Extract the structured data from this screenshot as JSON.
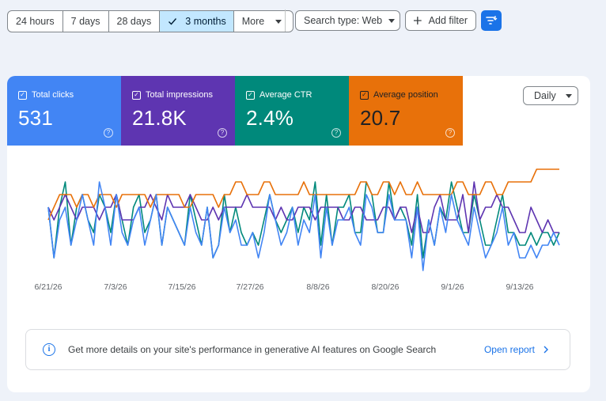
{
  "toolbar": {
    "ranges": [
      {
        "label": "24 hours",
        "active": false
      },
      {
        "label": "7 days",
        "active": false
      },
      {
        "label": "28 days",
        "active": false
      },
      {
        "label": "3 months",
        "active": true
      },
      {
        "label": "More",
        "active": false
      }
    ],
    "search_type": "Search type: Web",
    "add_filter": "Add filter"
  },
  "metrics": [
    {
      "label": "Total clicks",
      "value": "531",
      "color": "#4285f4"
    },
    {
      "label": "Total impressions",
      "value": "21.8K",
      "color": "#5e35b1"
    },
    {
      "label": "Average CTR",
      "value": "2.4%",
      "color": "#00897b"
    },
    {
      "label": "Average position",
      "value": "20.7",
      "color": "#e8710a"
    }
  ],
  "granularity": "Daily",
  "chart_data": {
    "type": "line",
    "x_tick_labels": [
      "6/21/26",
      "7/3/26",
      "7/15/26",
      "7/27/26",
      "8/8/26",
      "8/20/26",
      "9/1/26",
      "9/13/26"
    ],
    "grid": false,
    "series": [
      {
        "name": "Total clicks",
        "color": "#4285f4",
        "values": [
          5,
          1,
          4,
          5,
          2,
          4,
          6,
          4,
          2,
          7,
          5,
          2,
          6,
          3,
          2,
          4,
          5,
          2,
          4,
          6,
          2,
          5,
          4,
          3,
          2,
          5,
          3,
          2,
          5,
          1,
          2,
          5,
          3,
          4,
          2,
          2,
          3,
          1,
          3,
          6,
          4,
          2,
          3,
          5,
          2,
          4,
          3,
          6,
          1,
          5,
          2,
          4,
          4,
          5,
          3,
          2,
          6,
          5,
          3,
          3,
          6,
          4,
          4,
          4,
          1,
          5,
          0,
          4,
          2,
          5,
          3,
          6,
          4,
          3,
          2,
          5,
          3,
          1,
          2,
          3,
          5,
          2,
          3,
          1,
          1,
          2,
          1,
          2,
          2,
          3,
          2
        ]
      },
      {
        "name": "Total impressions",
        "color": "#5e35b1",
        "values": [
          5,
          4,
          5,
          6,
          5,
          4,
          5,
          5,
          5,
          4,
          5,
          5,
          6,
          4,
          4,
          4,
          5,
          5,
          6,
          5,
          4,
          6,
          5,
          5,
          5,
          6,
          5,
          4,
          4,
          5,
          4,
          5,
          5,
          5,
          5,
          6,
          5,
          5,
          5,
          5,
          4,
          5,
          4,
          4,
          5,
          5,
          5,
          4,
          5,
          5,
          5,
          5,
          4,
          4,
          5,
          5,
          4,
          4,
          4,
          5,
          5,
          4,
          5,
          5,
          3,
          5,
          3,
          3,
          5,
          6,
          4,
          4,
          4,
          6,
          3,
          7,
          4,
          5,
          5,
          6,
          5,
          5,
          4,
          3,
          3,
          5,
          4,
          3,
          4,
          3,
          3
        ]
      },
      {
        "name": "Average CTR",
        "color": "#00897b",
        "values": [
          5,
          1,
          5,
          7,
          2,
          5,
          6,
          4,
          3,
          6,
          5,
          3,
          6,
          4,
          2,
          5,
          6,
          3,
          4,
          6,
          2,
          5,
          4,
          3,
          2,
          6,
          4,
          2,
          5,
          1,
          2,
          6,
          3,
          5,
          3,
          2,
          3,
          2,
          4,
          6,
          4,
          3,
          4,
          5,
          3,
          5,
          4,
          7,
          2,
          6,
          2,
          5,
          5,
          6,
          3,
          3,
          7,
          6,
          3,
          3,
          7,
          4,
          5,
          4,
          2,
          6,
          1,
          4,
          2,
          5,
          4,
          7,
          5,
          3,
          3,
          6,
          4,
          2,
          2,
          4,
          6,
          3,
          3,
          2,
          2,
          3,
          2,
          3,
          3,
          2,
          3
        ]
      },
      {
        "name": "Average position",
        "color": "#e8710a",
        "values": [
          4,
          5,
          6,
          6,
          6,
          5,
          6,
          6,
          5,
          6,
          6,
          6,
          5,
          6,
          6,
          6,
          6,
          6,
          5,
          6,
          6,
          6,
          6,
          6,
          5,
          5,
          6,
          6,
          6,
          6,
          5,
          6,
          6,
          7,
          7,
          6,
          6,
          6,
          7,
          7,
          6,
          6,
          6,
          6,
          6,
          7,
          6,
          6,
          6,
          6,
          6,
          6,
          6,
          6,
          6,
          7,
          7,
          6,
          6,
          7,
          7,
          6,
          7,
          6,
          6,
          7,
          6,
          6,
          6,
          6,
          6,
          6,
          7,
          7,
          6,
          6,
          6,
          7,
          7,
          6,
          6,
          7,
          7,
          7,
          7,
          7,
          8,
          8,
          8,
          8,
          8
        ]
      }
    ]
  },
  "banner": {
    "message": "Get more details on your site's performance in generative AI features on Google Search",
    "link": "Open report"
  }
}
